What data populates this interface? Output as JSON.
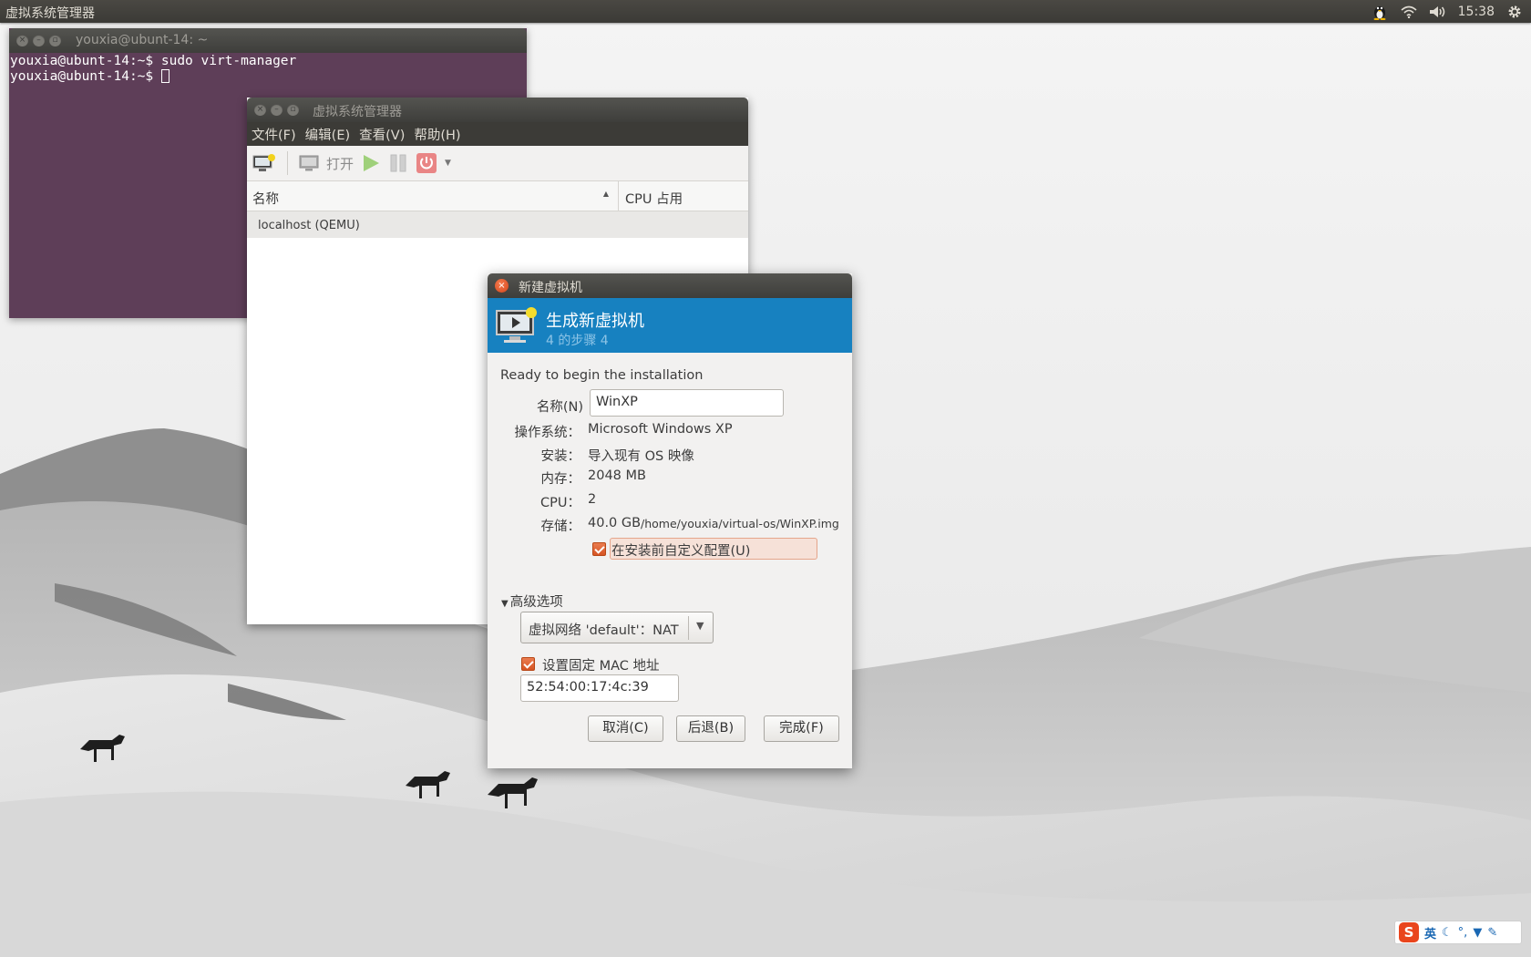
{
  "top_panel": {
    "app_title": "虚拟系统管理器",
    "clock": "15:38",
    "icons": [
      "tux-icon",
      "wifi-icon",
      "volume-icon",
      "gear-icon"
    ]
  },
  "terminal": {
    "title": "youxia@ubunt-14: ~",
    "lines": [
      "youxia@ubunt-14:~$ sudo virt-manager",
      "youxia@ubunt-14:~$ "
    ]
  },
  "vm_manager": {
    "title": "虚拟系统管理器",
    "menu": [
      "文件(F)",
      "编辑(E)",
      "查看(V)",
      "帮助(H)"
    ],
    "toolbar": {
      "open_label": "打开"
    },
    "columns": {
      "name": "名称",
      "cpu": "CPU 占用"
    },
    "rows": [
      {
        "name": "localhost (QEMU)"
      }
    ]
  },
  "dialog": {
    "title": "新建虚拟机",
    "banner_title": "生成新虚拟机",
    "banner_subtitle": "4 的步骤 4",
    "ready_text": "Ready to begin the installation",
    "name_label": "名称(N)",
    "name_value": "WinXP",
    "os_label": "操作系统：",
    "os_value": "Microsoft Windows XP",
    "install_label": "安装：",
    "install_value": "导入现有 OS 映像",
    "memory_label": "内存：",
    "memory_value": "2048 MB",
    "cpu_label": "CPU：",
    "cpu_value": "2",
    "storage_label": "存储：",
    "storage_size": "40.0 GB",
    "storage_path": "/home/youxia/virtual-os/WinXP.img",
    "customize_label": "在安装前自定义配置(U)",
    "customize_checked": true,
    "advanced_label": "高级选项",
    "network_value": "虚拟网络 'default'：NAT",
    "mac_checkbox_label": "设置固定 MAC 地址",
    "mac_checked": true,
    "mac_value": "52:54:00:17:4c:39",
    "cancel_label": "取消(C)",
    "back_label": "后退(B)",
    "finish_label": "完成(F)"
  },
  "ime": {
    "mode": "英"
  },
  "colors": {
    "banner": "#1781c0",
    "terminal_bg": "#5e3e58",
    "accent_orange": "#dd5a2a"
  }
}
